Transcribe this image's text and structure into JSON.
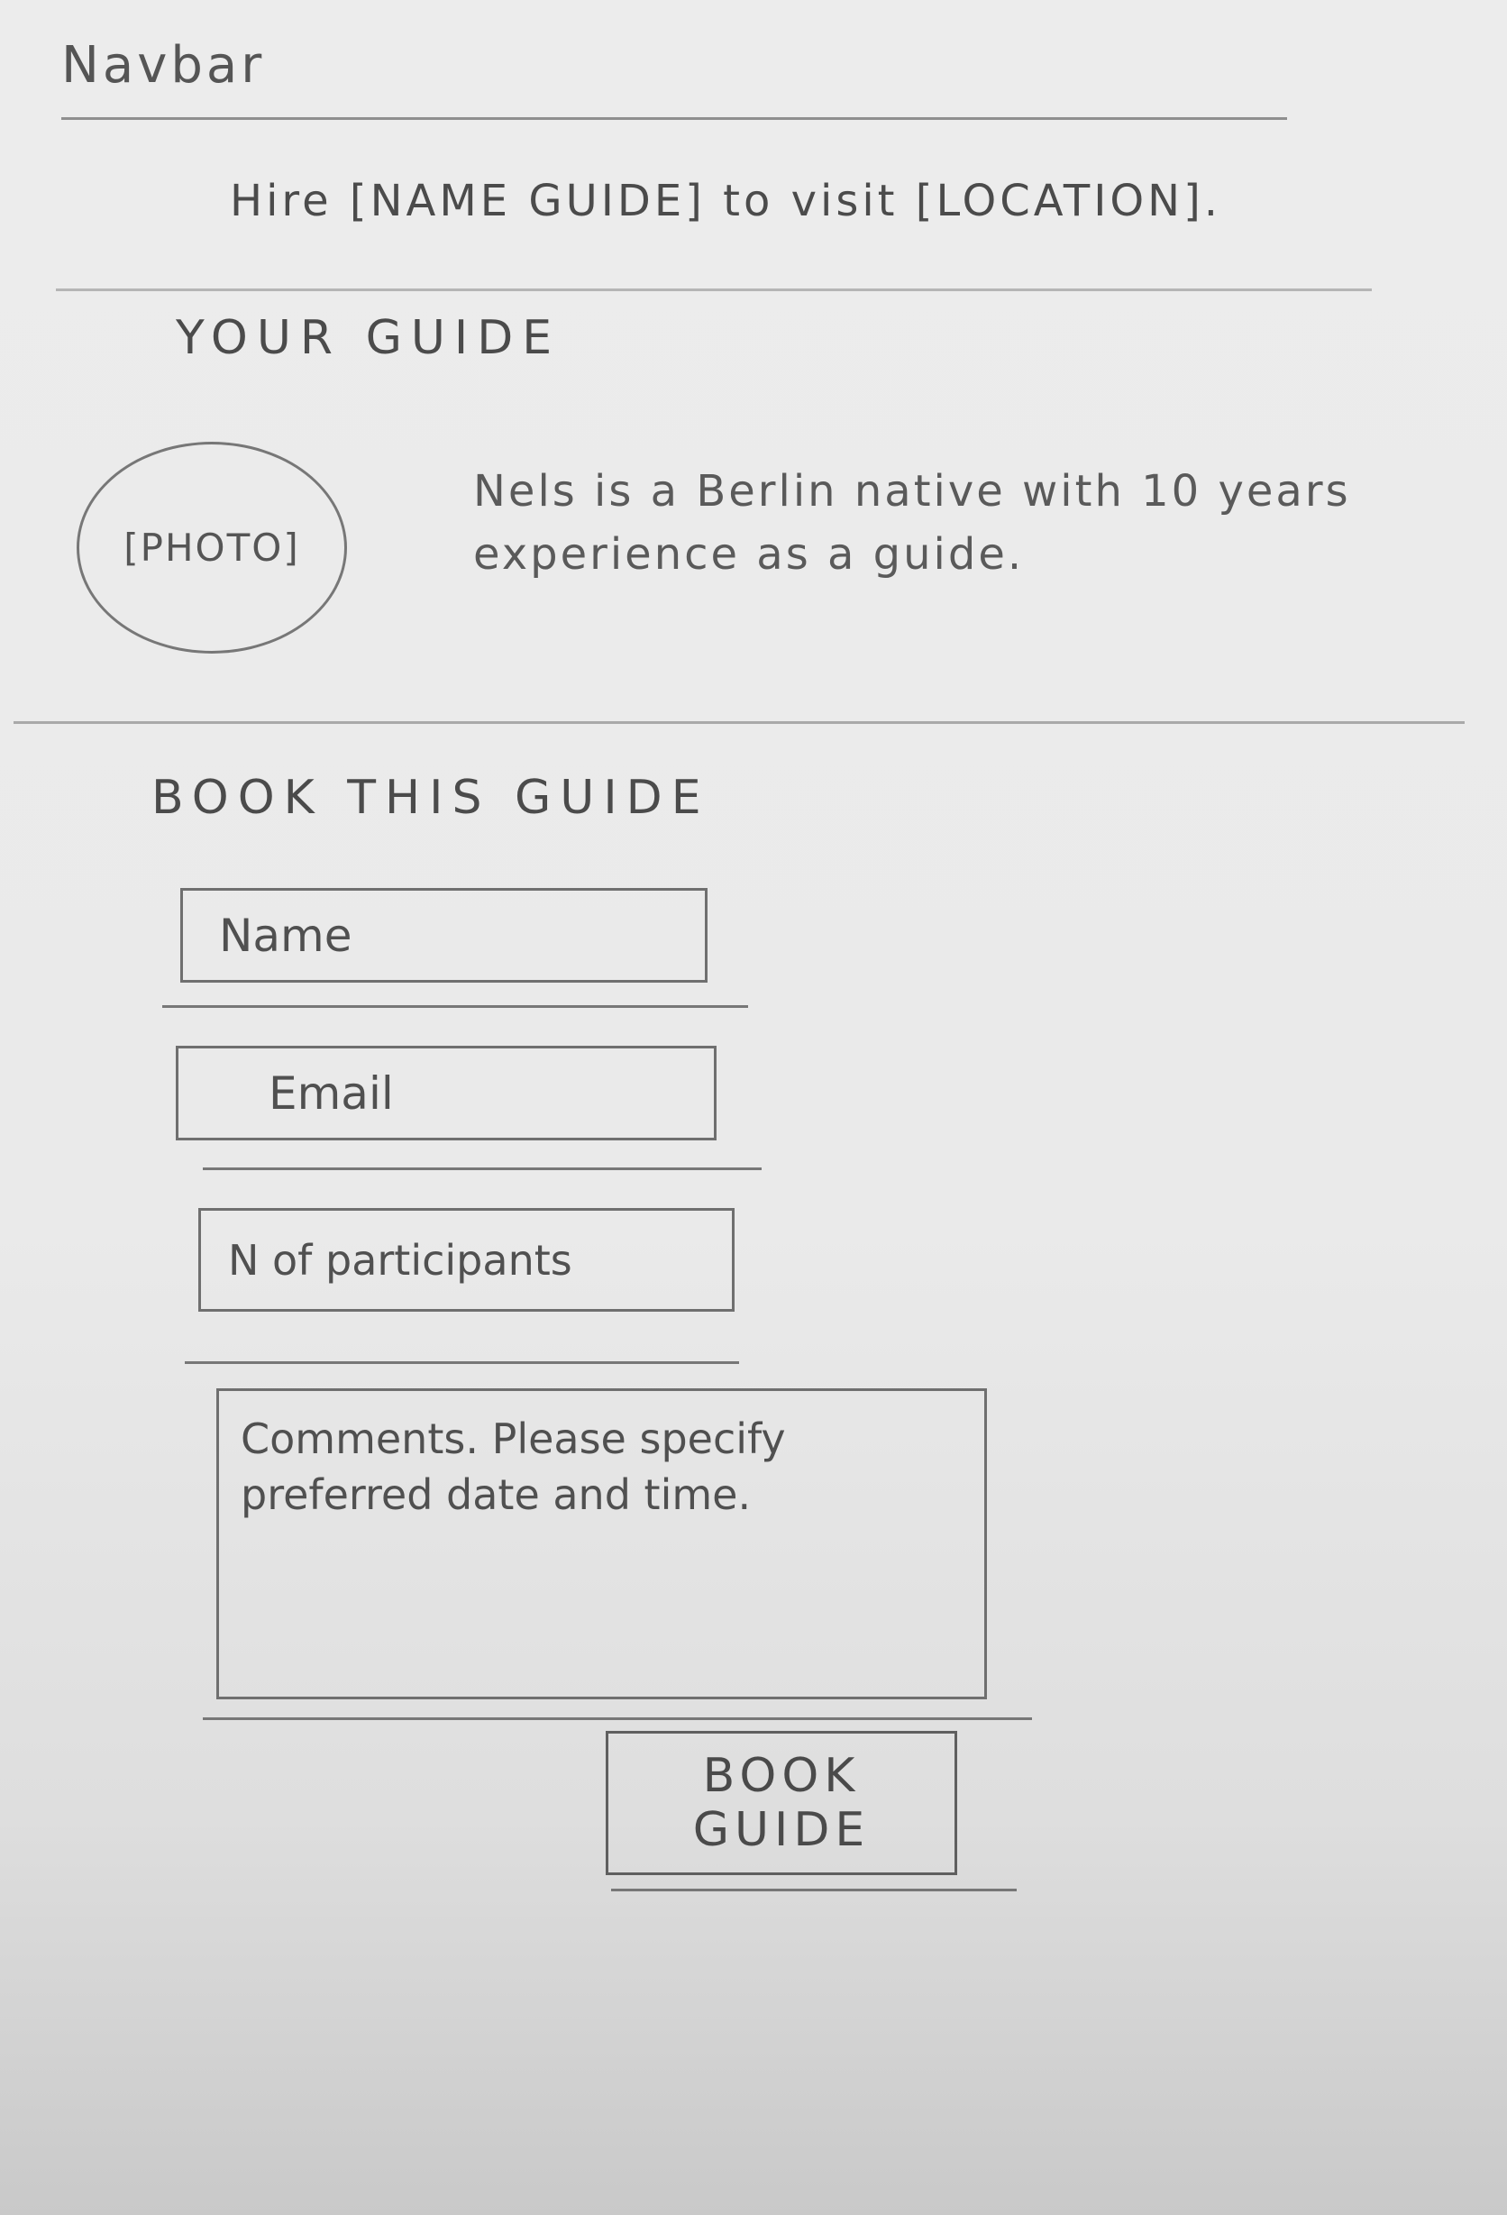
{
  "navbar": {
    "label": "Navbar"
  },
  "header": {
    "title": "Hire [NAME GUIDE] to visit [LOCATION]."
  },
  "guide_section": {
    "heading": "YOUR GUIDE",
    "photo_label": "[PHOTO]",
    "bio": "Nels is a Berlin native with 10 years experience as a guide."
  },
  "booking": {
    "heading": "BOOK THIS GUIDE",
    "name_placeholder": "Name",
    "email_placeholder": "Email",
    "participants_placeholder": "N of participants",
    "comments_placeholder": "Comments. Please specify preferred date and time.",
    "submit_label": "BOOK GUIDE"
  }
}
